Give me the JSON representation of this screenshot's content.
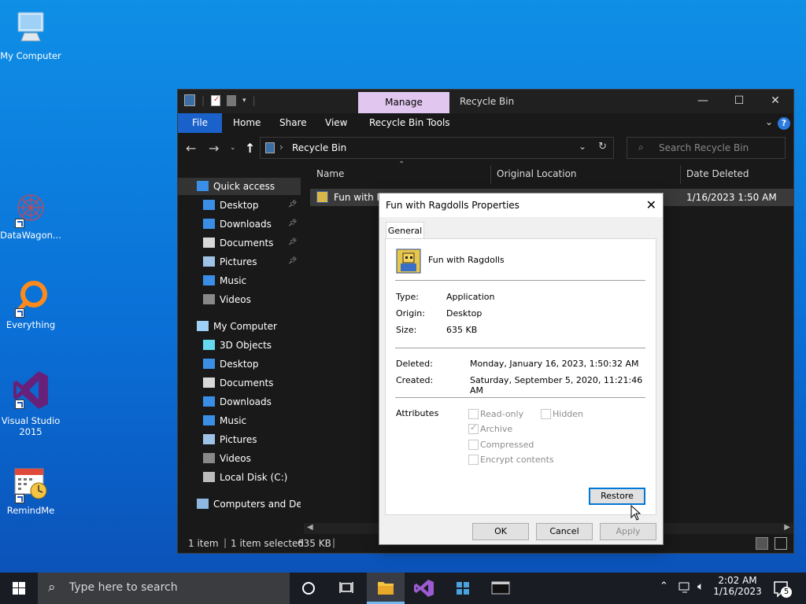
{
  "desktop": {
    "icons": [
      {
        "label": "My Computer",
        "icon": "computer-icon"
      },
      {
        "label": "DataWagon...",
        "icon": "datawagon-icon"
      },
      {
        "label": "Everything",
        "icon": "everything-icon"
      },
      {
        "label": "Visual Studio 2015",
        "line1": "Visual Studio",
        "line2": "2015",
        "icon": "visual-studio-icon"
      },
      {
        "label": "RemindMe",
        "icon": "calendar-clock-icon"
      }
    ]
  },
  "explorer": {
    "title": "Recycle Bin",
    "manage_tab": "Manage",
    "ribbon_tabs": [
      "File",
      "Home",
      "Share",
      "View",
      "Recycle Bin Tools"
    ],
    "address": "Recycle Bin",
    "search_placeholder": "Search Recycle Bin",
    "columns": [
      "Name",
      "Original Location",
      "Date Deleted"
    ],
    "nav": [
      {
        "label": "Quick access",
        "icon": "star-icon",
        "pinned": false,
        "indent": 0
      },
      {
        "label": "Desktop",
        "icon": "desktop-icon",
        "pinned": true,
        "indent": 1
      },
      {
        "label": "Downloads",
        "icon": "download-icon",
        "pinned": true,
        "indent": 1
      },
      {
        "label": "Documents",
        "icon": "document-icon",
        "pinned": true,
        "indent": 1
      },
      {
        "label": "Pictures",
        "icon": "pictures-icon",
        "pinned": true,
        "indent": 1
      },
      {
        "label": "Music",
        "icon": "music-icon",
        "pinned": false,
        "indent": 1
      },
      {
        "label": "Videos",
        "icon": "video-icon",
        "pinned": false,
        "indent": 1
      },
      {
        "label": "My Computer",
        "icon": "computer-icon",
        "pinned": false,
        "indent": 0
      },
      {
        "label": "3D Objects",
        "icon": "cube-icon",
        "pinned": false,
        "indent": 1
      },
      {
        "label": "Desktop",
        "icon": "desktop-icon",
        "pinned": false,
        "indent": 1
      },
      {
        "label": "Documents",
        "icon": "document-icon",
        "pinned": false,
        "indent": 1
      },
      {
        "label": "Downloads",
        "icon": "download-icon",
        "pinned": false,
        "indent": 1
      },
      {
        "label": "Music",
        "icon": "music-icon",
        "pinned": false,
        "indent": 1
      },
      {
        "label": "Pictures",
        "icon": "pictures-icon",
        "pinned": false,
        "indent": 1
      },
      {
        "label": "Videos",
        "icon": "video-icon",
        "pinned": false,
        "indent": 1
      },
      {
        "label": "Local Disk (C:)",
        "icon": "drive-icon",
        "pinned": false,
        "indent": 1
      },
      {
        "label": "Computers and Devic",
        "icon": "network-icon",
        "pinned": false,
        "indent": 0
      }
    ],
    "file_row": {
      "name": "Fun with R",
      "date_deleted": "1/16/2023 1:50 AM"
    },
    "status": {
      "count": "1 item",
      "selected": "1 item selected",
      "size": "635 KB"
    }
  },
  "dialog": {
    "title": "Fun with Ragdolls Properties",
    "tab": "General",
    "file_name": "Fun with Ragdolls",
    "type_label": "Type:",
    "type_value": "Application",
    "origin_label": "Origin:",
    "origin_value": "Desktop",
    "size_label": "Size:",
    "size_value": "635 KB",
    "deleted_label": "Deleted:",
    "deleted_value": "Monday, January 16, 2023, 1:50:32 AM",
    "created_label": "Created:",
    "created_value": "Saturday, September 5, 2020, 11:21:46 AM",
    "attributes_label": "Attributes",
    "attrs": {
      "read_only": "Read-only",
      "hidden": "Hidden",
      "archive": "Archive",
      "compressed": "Compressed",
      "encrypt": "Encrypt contents"
    },
    "restore": "Restore",
    "ok": "OK",
    "cancel": "Cancel",
    "apply": "Apply"
  },
  "taskbar": {
    "search_placeholder": "Type here to search",
    "time": "2:02 AM",
    "date": "1/16/2023",
    "notification_count": "5"
  },
  "colors": {
    "desktop_blue": "#0a6fd6",
    "explorer_bg": "#191919",
    "manage_tab": "#e1c7f0",
    "file_tab": "#1a62c9",
    "accent": "#0078d7"
  }
}
